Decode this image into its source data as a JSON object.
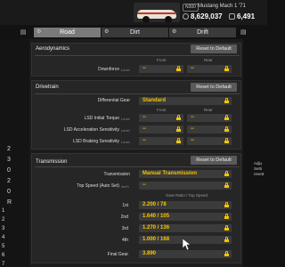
{
  "header": {
    "badge": "N300",
    "car_name": "Mustang Mach 1 '71",
    "credits": "8,629,037",
    "mileage": "6,491"
  },
  "tabs": [
    {
      "label": "Road",
      "active": true
    },
    {
      "label": "Dirt",
      "active": false
    },
    {
      "label": "Drift",
      "active": false
    }
  ],
  "left_panel": {
    "items": [
      "2",
      "3",
      "0",
      "2",
      "0",
      "R"
    ],
    "items2": [
      "1",
      "2",
      "3",
      "4",
      "5",
      "6",
      "7"
    ]
  },
  "aerodynamics": {
    "title": "Aerodynamics",
    "reset_label": "Reset to Default",
    "col_front": "Front",
    "col_rear": "Rear",
    "downforce_label": "Downforce",
    "downforce_unit": "Level",
    "front_value": "--",
    "rear_value": "--"
  },
  "drivetrain": {
    "title": "Drivetrain",
    "reset_label": "Reset to Default",
    "diff_label": "Differential Gear",
    "diff_value": "Standard",
    "col_front": "Front",
    "col_rear": "Rear",
    "rows": [
      {
        "label": "LSD Initial Torque",
        "unit": "Level",
        "front": "--",
        "rear": "--"
      },
      {
        "label": "LSD Acceleration Sensitivity",
        "unit": "Level",
        "front": "--",
        "rear": "--"
      },
      {
        "label": "LSD Braking Sensitivity",
        "unit": "Level",
        "front": "--",
        "rear": "--"
      }
    ]
  },
  "transmission": {
    "title": "Transmission",
    "reset_label": "Reset to Default",
    "trans_label": "Transmission",
    "trans_value": "Manual Transmission",
    "topspeed_label": "Top Speed (Auto Set)",
    "topspeed_unit": "km/h",
    "topspeed_value": "--",
    "gear_header": "Gear Ratio / Top Speed",
    "gears": [
      {
        "label": "1st",
        "value": "2.200 / 78"
      },
      {
        "label": "2nd",
        "value": "1.640 / 105"
      },
      {
        "label": "3rd",
        "value": "1.270 / 136"
      },
      {
        "label": "4th",
        "value": "1.000 / 168"
      }
    ],
    "final_label": "Final Gear",
    "final_value": "3.890"
  },
  "right_panel": {
    "lines": [
      "Adju",
      "Setti",
      "resett"
    ]
  },
  "colors": {
    "accent": "#f5c400",
    "active_tab": "#7a7a7a",
    "panel": "#262626"
  }
}
